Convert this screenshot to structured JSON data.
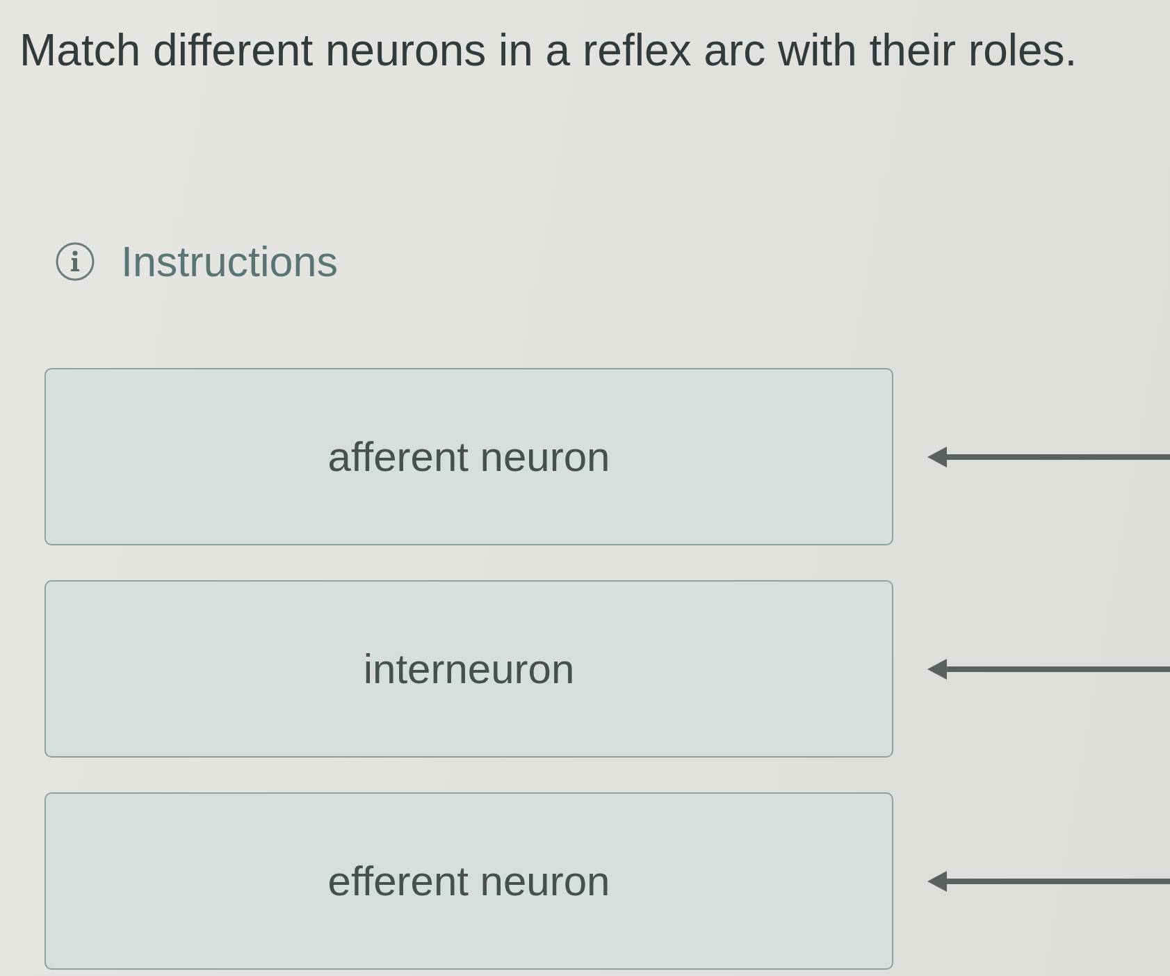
{
  "question": {
    "text": "Match different neurons in a reflex arc with their roles."
  },
  "instructions": {
    "label": "Instructions"
  },
  "items": [
    {
      "label": "afferent neuron"
    },
    {
      "label": "interneuron"
    },
    {
      "label": "efferent neuron"
    }
  ]
}
